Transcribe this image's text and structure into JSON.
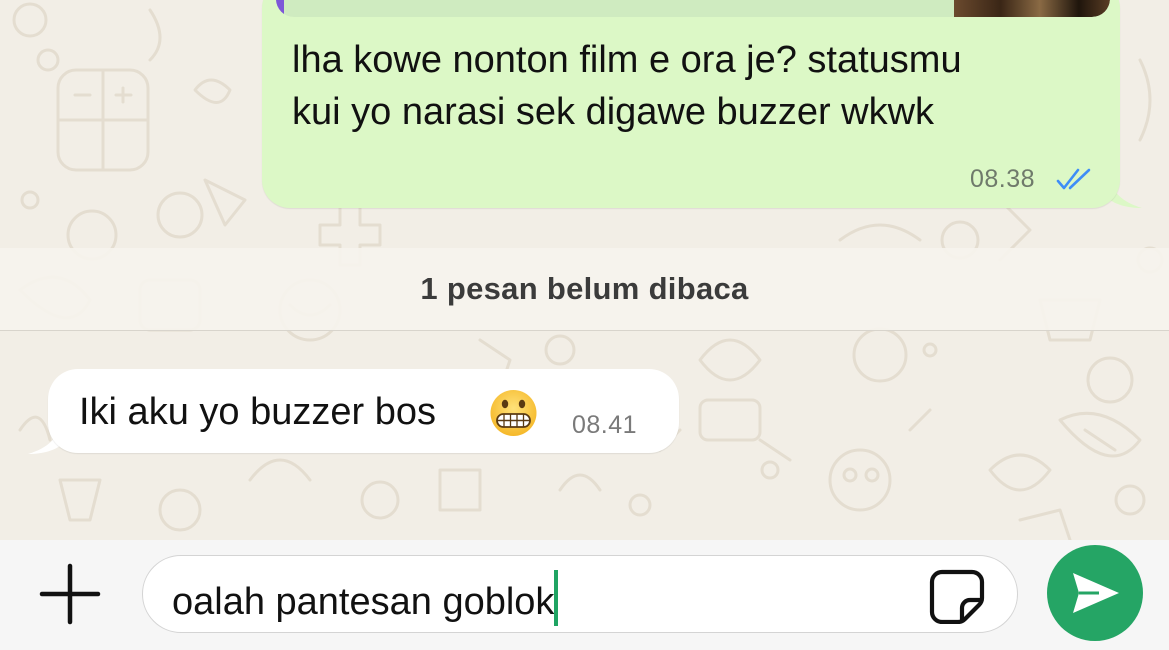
{
  "chat": {
    "outgoing_message": {
      "text": "lha kowe nonton film e ora je? statusmu\nkui yo narasi sek digawe buzzer wkwk",
      "time": "08.38",
      "status_icon": "double-check-read-icon"
    },
    "unread_banner": "1 pesan belum dibaca",
    "incoming_message": {
      "text": "Iki aku yo buzzer bos",
      "emoji": "grimacing-face-icon",
      "time": "08.41"
    }
  },
  "composer": {
    "attach_icon": "plus-icon",
    "input_value": "oalah pantesan goblok",
    "sticker_icon": "sticker-icon",
    "send_icon": "send-arrow-icon"
  },
  "colors": {
    "outgoing_bubble": "#dcf8c6",
    "incoming_bubble": "#ffffff",
    "read_ticks": "#3e8ef7",
    "send_button": "#25a565",
    "caret": "#1fa463",
    "wallpaper": "#f2eee6"
  }
}
